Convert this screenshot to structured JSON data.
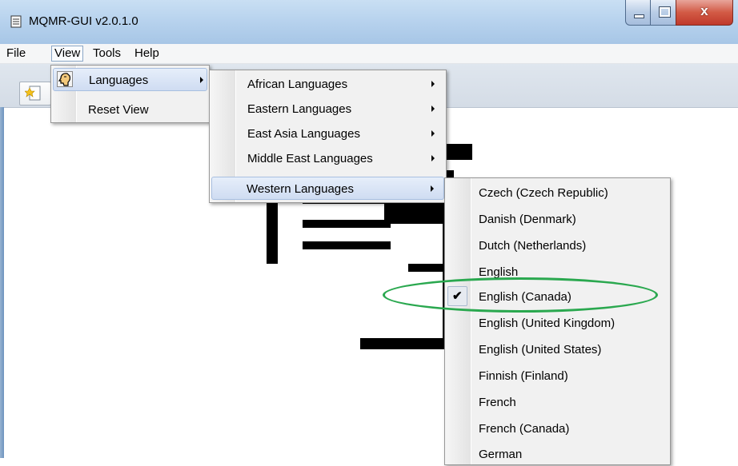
{
  "window": {
    "title": "MQMR-GUI v2.0.1.0",
    "close_glyph": "x"
  },
  "menubar": [
    "File",
    "View",
    "Tools",
    "Help"
  ],
  "view_menu": {
    "items": [
      {
        "label": "Languages",
        "icon": "language-head-icon",
        "has_submenu": true
      },
      {
        "label": "Reset View",
        "has_submenu": false
      }
    ]
  },
  "languages_menu": {
    "items": [
      {
        "label": "African Languages",
        "has_submenu": true
      },
      {
        "label": "Eastern Languages",
        "has_submenu": true
      },
      {
        "label": "East Asia Languages",
        "has_submenu": true
      },
      {
        "label": "Middle East Languages",
        "has_submenu": true
      },
      {
        "label": "Western Languages",
        "has_submenu": true
      }
    ]
  },
  "western_menu": {
    "items": [
      "Czech (Czech Republic)",
      "Danish (Denmark)",
      "Dutch (Netherlands)",
      "English",
      "English (Canada)",
      "English (United Kingdom)",
      "English (United States)",
      "Finnish (Finland)",
      "French",
      "French (Canada)",
      "German"
    ],
    "checked": "English (Canada)",
    "check_glyph": "✔"
  },
  "colors": {
    "annotation": "#2aa84f",
    "highlight": "#cfdcf2"
  }
}
